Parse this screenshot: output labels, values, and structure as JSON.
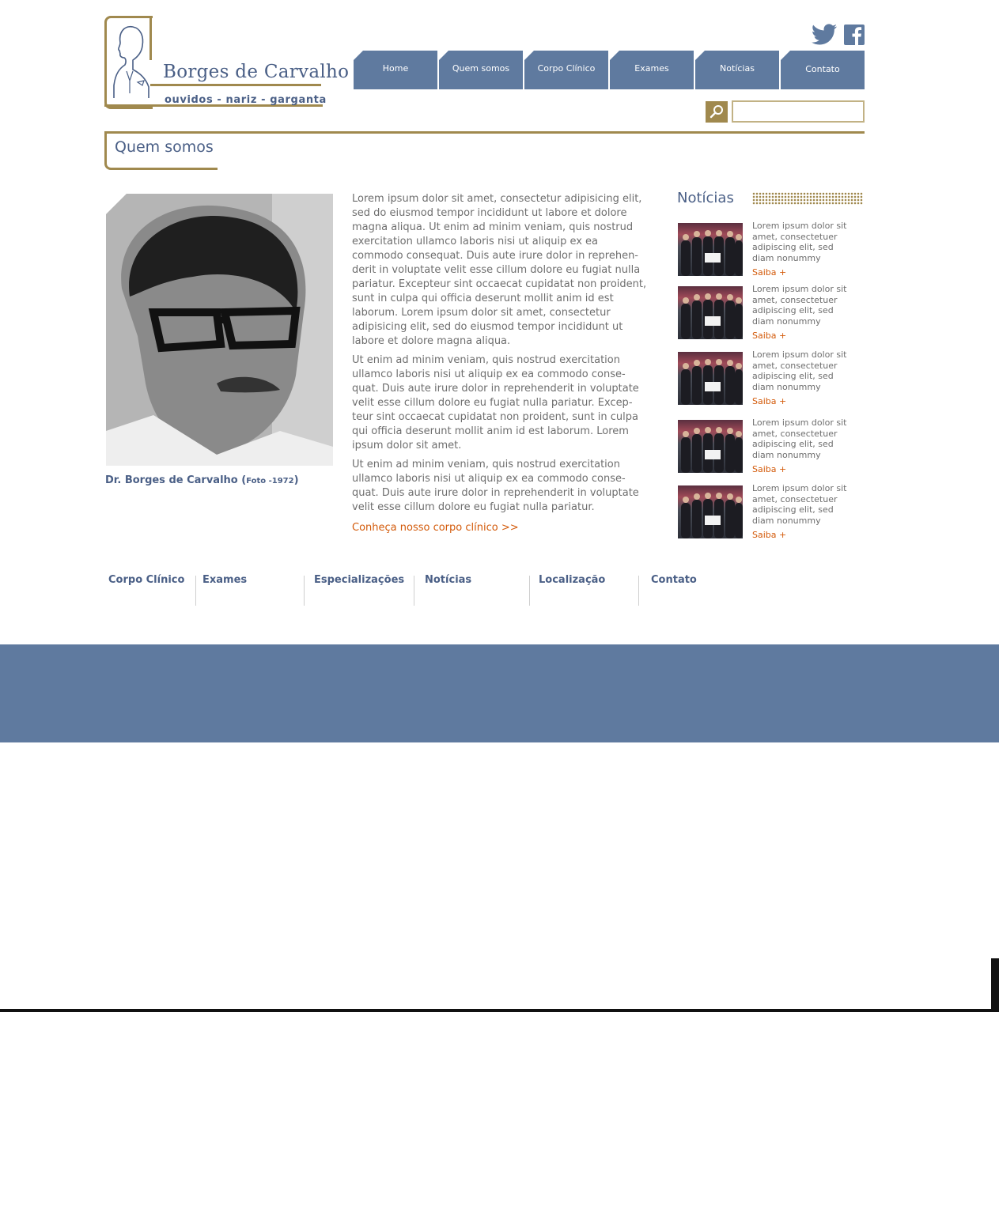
{
  "brand": {
    "name": "Borges de Carvalho",
    "tagline": "ouvidos - nariz - garganta"
  },
  "social": {
    "twitter_icon": "twitter-icon",
    "facebook_icon": "facebook-icon"
  },
  "nav": {
    "items": [
      {
        "label": "Home"
      },
      {
        "label": "Quem somos"
      },
      {
        "label": "Corpo Clínico"
      },
      {
        "label": "Exames"
      },
      {
        "label": "Notícias"
      },
      {
        "label": "Contato"
      }
    ]
  },
  "search": {
    "placeholder": ""
  },
  "page": {
    "title": "Quem somos"
  },
  "portrait": {
    "caption_name": "Dr. Borges de Carvalho (",
    "caption_note": "Foto -1972",
    "caption_end": ")"
  },
  "content": {
    "paragraphs": [
      "Lorem ipsum dolor sit amet, consectetur adipisicing elit, sed do eiusmod tempor incididunt ut labore et dolore magna aliqua. Ut enim ad minim veniam, quis nostrud exercitation ullamco laboris nisi ut aliquip ex ea commodo consequat. Duis aute irure dolor in reprehen-derit in voluptate velit esse cillum dolore eu fugiat nulla pariatur. Excepteur sint occaecat cupidatat non proident, sunt in culpa qui officia deserunt mollit anim id est laborum. Lorem ipsum dolor sit amet, consectetur adipisicing elit, sed do eiusmod tempor incididunt ut labore et dolore magna aliqua.",
      "Ut enim ad minim veniam, quis nostrud exercitation ullamco laboris nisi ut aliquip ex ea commodo conse-quat. Duis aute irure dolor in reprehenderit in voluptate velit esse cillum dolore eu fugiat nulla pariatur. Excep-teur sint occaecat cupidatat non proident, sunt in culpa qui officia deserunt mollit anim id est laborum. Lorem ipsum dolor sit amet.",
      "Ut enim ad minim veniam, quis nostrud exercitation ullamco laboris nisi ut aliquip ex ea commodo conse-quat. Duis aute irure dolor in reprehenderit in voluptate velit esse cillum dolore eu fugiat nulla pariatur."
    ],
    "more_link": "Conheça nosso corpo clínico >>"
  },
  "news": {
    "title": "Notícias",
    "items": [
      {
        "text": "Lorem ipsum dolor sit amet, consectetuer adipiscing elit, sed diam nonummy",
        "more": "Saiba +"
      },
      {
        "text": "Lorem ipsum dolor sit amet, consectetuer adipiscing elit, sed diam nonummy",
        "more": "Saiba +"
      },
      {
        "text": "Lorem ipsum dolor sit amet, consectetuer adipiscing elit, sed diam nonummy",
        "more": "Saiba +"
      },
      {
        "text": "Lorem ipsum dolor sit amet, consectetuer adipiscing elit, sed diam nonummy",
        "more": "Saiba +"
      },
      {
        "text": "Lorem ipsum dolor sit amet, consectetuer adipiscing elit, sed diam nonummy",
        "more": "Saiba +"
      }
    ]
  },
  "footer": {
    "links": [
      "Corpo Clínico",
      "Exames",
      "Especializações",
      "Notícias",
      "Localização",
      "Contato"
    ]
  },
  "colors": {
    "brand_blue": "#5f7a9f",
    "brand_gold": "#a0894e",
    "link_orange": "#d35a0a",
    "text_gray": "#6e6e6e"
  }
}
